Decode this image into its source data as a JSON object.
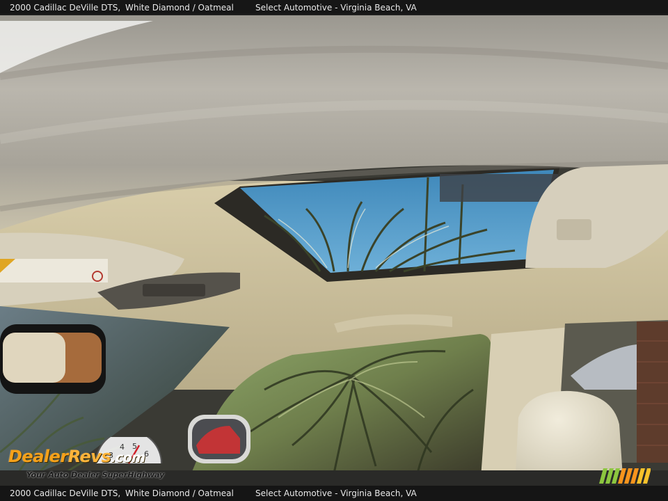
{
  "caption": {
    "vehicle": "2000 Cadillac DeVille DTS,",
    "colors": "White Diamond / Oatmeal",
    "dealer": "Select Automotive - Virginia Beach, VA"
  },
  "watermark": {
    "brand_dealer": "Dealer",
    "brand_revs": "Revs",
    "brand_com": ".com",
    "tagline": "Your Auto Dealer SuperHighway",
    "gauge_digits": [
      "3",
      "4",
      "5",
      "6"
    ]
  },
  "colors": {
    "headliner": "#b9b4aa",
    "headliner_shadow": "#7a766d",
    "sky": "#4c95c4",
    "palm": "#3f4a2c",
    "leather": "#e3ddc8",
    "logo_orange": "#f5a11a",
    "stripe_green": "#8cc63f",
    "stripe_orange": "#f7941d"
  }
}
